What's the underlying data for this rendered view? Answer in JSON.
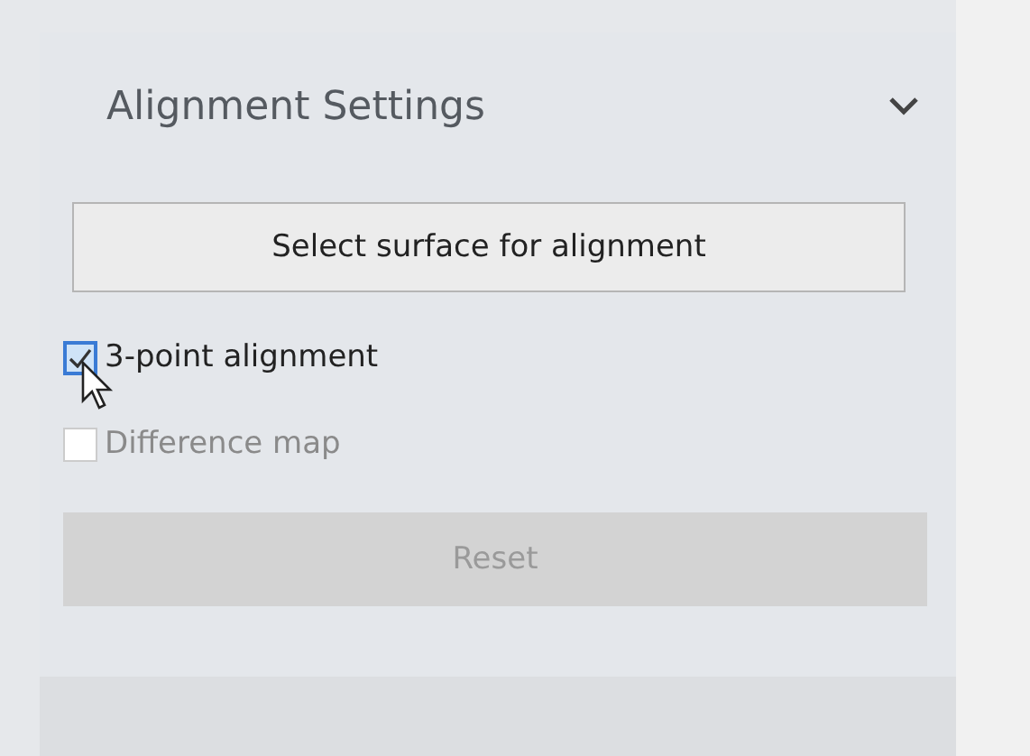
{
  "panel": {
    "title": "Alignment Settings",
    "expanded": true
  },
  "surface_button": {
    "label": "Select surface for alignment"
  },
  "options": [
    {
      "label": "3-point alignment",
      "checked": true,
      "disabled": false
    },
    {
      "label": "Difference map",
      "checked": false,
      "disabled": true
    }
  ],
  "reset_button": {
    "label": "Reset",
    "disabled": true
  }
}
